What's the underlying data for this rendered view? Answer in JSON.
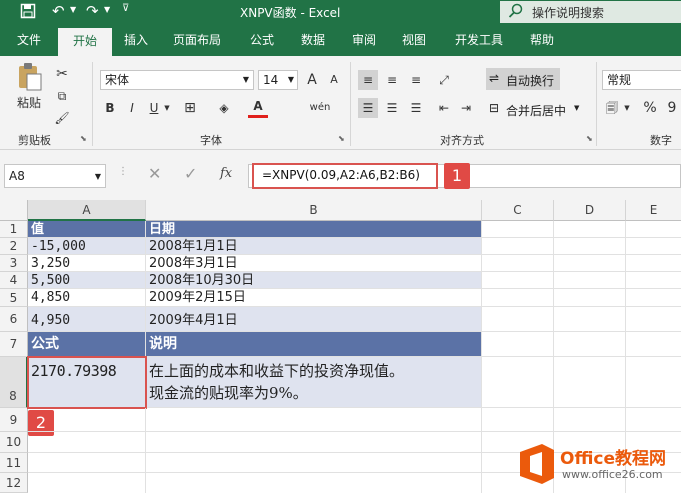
{
  "window": {
    "title": "XNPV函数  -  Excel",
    "search_placeholder": "操作说明搜索"
  },
  "ribbon_tabs": [
    "文件",
    "开始",
    "插入",
    "页面布局",
    "公式",
    "数据",
    "审阅",
    "视图",
    "开发工具",
    "帮助"
  ],
  "ribbon": {
    "clipboard": {
      "paste_label": "粘贴",
      "group_label": "剪贴板"
    },
    "font": {
      "font_name": "宋体",
      "font_size": "14",
      "bold": "B",
      "italic": "I",
      "underline": "U",
      "grow": "A",
      "shrink": "A",
      "phonetic": "wén",
      "group_label": "字体"
    },
    "alignment": {
      "wrap_text": "自动换行",
      "merge_center": "合并后居中",
      "group_label": "对齐方式"
    },
    "number": {
      "format": "常规",
      "percent": "%",
      "comma": "9",
      "group_label": "数字"
    }
  },
  "formula_bar": {
    "name_box": "A8",
    "fx": "fx",
    "formula": "=XNPV(0.09,A2:A6,B2:B6)"
  },
  "badges": {
    "one": "1",
    "two": "2"
  },
  "columns": [
    "A",
    "B",
    "C",
    "D",
    "E"
  ],
  "rows": [
    "1",
    "2",
    "3",
    "4",
    "5",
    "6",
    "7",
    "8",
    "9",
    "10",
    "11",
    "12"
  ],
  "cells": {
    "a1": "值",
    "b1": "日期",
    "a2": "-15,000",
    "b2": "2008年1月1日",
    "a3": "3,250",
    "b3": "2008年3月1日",
    "a4": "5,500",
    "b4": "2008年10月30日",
    "a5": "4,850",
    "b5": "2009年2月15日",
    "a6": "4,950",
    "b6": "2009年4月1日",
    "a7": "公式",
    "b7": "说明",
    "a8": "2170.79398",
    "b8_line1": "在上面的成本和收益下的投资净现值。",
    "b8_line2": "现金流的贴现率为9%。"
  },
  "watermark": {
    "brand": "Office教程网",
    "url": "www.office26.com"
  },
  "colors": {
    "excel_green": "#217346",
    "header_blue": "#5b72a6",
    "zebra": "#dfe3ef",
    "highlight_red": "#e04a45"
  }
}
